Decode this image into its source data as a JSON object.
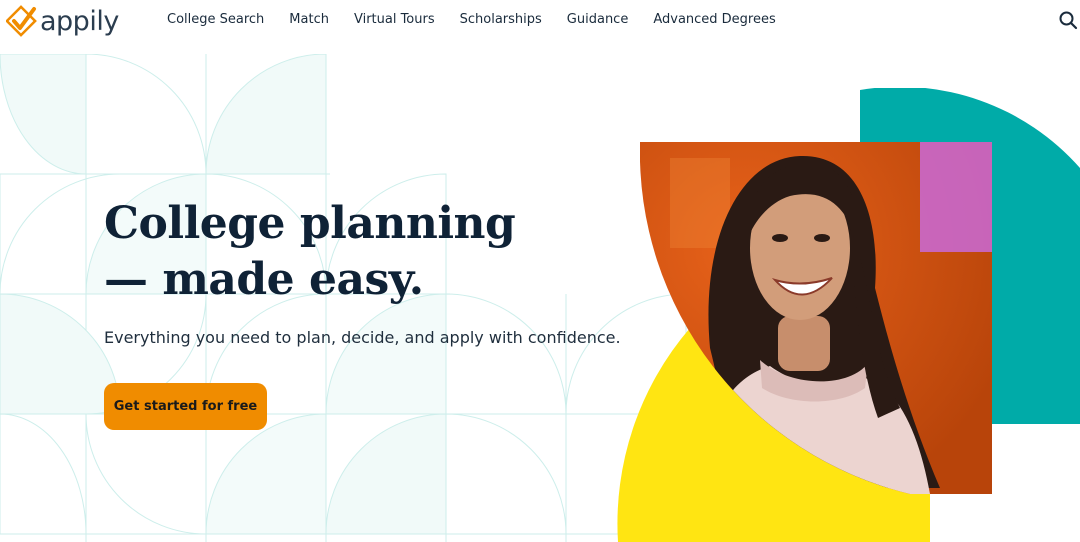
{
  "brand": {
    "name": "appily",
    "accent": "#f08c00"
  },
  "nav": {
    "items": [
      {
        "label": "College Search"
      },
      {
        "label": "Match"
      },
      {
        "label": "Virtual Tours"
      },
      {
        "label": "Scholarships"
      },
      {
        "label": "Guidance"
      },
      {
        "label": "Advanced Degrees"
      }
    ],
    "search_icon": "search-icon"
  },
  "hero": {
    "title_line1": "College planning",
    "title_line2": "— made easy.",
    "subtitle": "Everything you need to plan, decide, and apply with confidence.",
    "cta_label": "Get started for free"
  },
  "colors": {
    "teal": "#00aba8",
    "yellow": "#ffe512",
    "orange_photo": "#d9540e",
    "pattern_line": "#bfe9e6",
    "pattern_fill": "#eef9f8",
    "text_dark": "#0f2236"
  }
}
